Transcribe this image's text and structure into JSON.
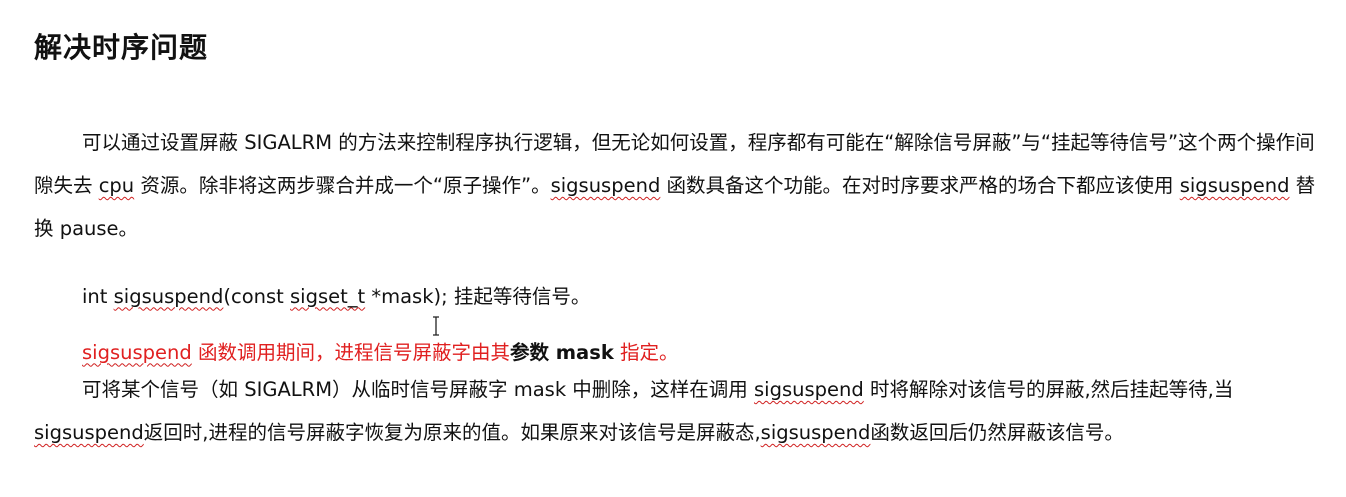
{
  "doc": {
    "title": "解决时序问题",
    "p1": {
      "a": "可以通过设置屏蔽 SIGALRM 的方法来控制程序执行逻辑，但无论如何设置，程序都有可能在“解除信号屏蔽”与“挂起等待信号”这个两个操作间隙失去 ",
      "b": "cpu",
      "c": " 资源。除非将这两步骤合并成一个“原子操作”。",
      "d": "sigsuspend",
      "e": " 函数具备这个功能。在对时序要求严格的场合下都应该使用 ",
      "f": "sigsuspend",
      "g": " 替换 pause。"
    },
    "sig": {
      "a": "int ",
      "b": "sigsuspend",
      "c": "(const ",
      "d": "sigset_t",
      "e": " *mask);    挂起等待信号。"
    },
    "red": {
      "a": "sigsuspend",
      "b": " 函数调用期间，进程信号屏蔽字由其",
      "c": "参数 mask",
      "d": " 指定。"
    },
    "p3": {
      "a": "可将某个信号（如 SIGALRM）从临时信号屏蔽字 mask 中删除，这样在调用 ",
      "b": "sigsuspend",
      "c": " 时将解除对该信号的屏蔽,然后挂起等待,当",
      "d": "sigsuspend",
      "e": "返回时,进程的信号屏蔽字恢复为原来的值。如果原来对该信号是屏蔽态,",
      "f": "sigsuspend",
      "g": "函数返回后仍然屏蔽该信号。"
    }
  },
  "colors": {
    "text": "#111111",
    "red": "#e02020",
    "squiggle": "#d02020"
  },
  "icons": {
    "cursor": "text-cursor-icon"
  }
}
